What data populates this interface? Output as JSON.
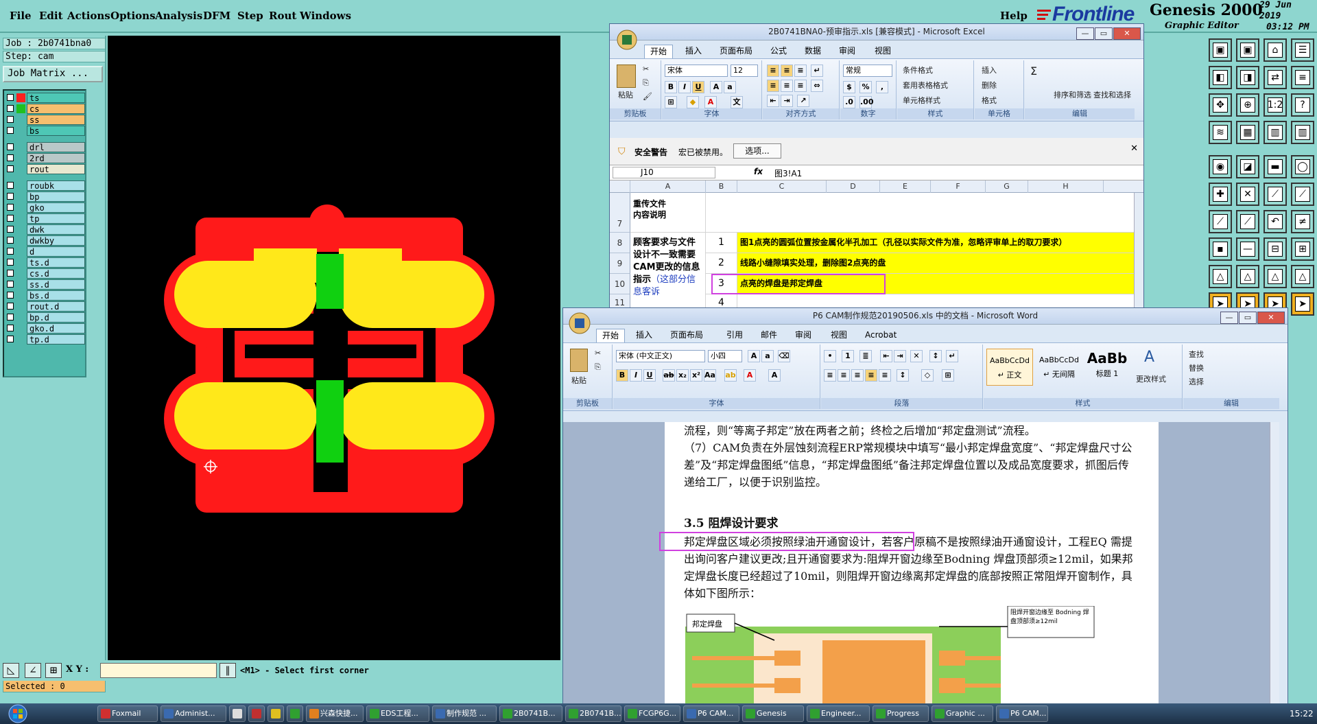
{
  "genesis": {
    "menu": [
      "File",
      "Edit",
      "Actions",
      "Options",
      "Analysis",
      "DFM",
      "Step",
      "Rout",
      "Windows"
    ],
    "help": "Help",
    "brand": "Frontline",
    "product": "Genesis 2000",
    "product_sub": "Graphic Editor",
    "date_line1": "29 Jun 2019",
    "date_line2": "03:12 PM",
    "job_label": "Job : 2b0741bna0",
    "step_label": "Step: cam",
    "job_matrix_btn": "Job Matrix ...",
    "layers": [
      {
        "name": "ts",
        "swatch": "#ff2020",
        "bg": "#4ec7b5"
      },
      {
        "name": "cs",
        "swatch": "#20c020",
        "bg": "#f6bf6f",
        "extra": "="
      },
      {
        "name": "ss",
        "swatch": "",
        "bg": "#f6bf6f"
      },
      {
        "name": "bs",
        "swatch": "",
        "bg": "#4ec7b5"
      },
      {
        "name": "drl",
        "swatch": "",
        "bg": "#b9c8c8"
      },
      {
        "name": "2rd",
        "swatch": "",
        "bg": "#b9c8c8"
      },
      {
        "name": "rout",
        "swatch": "",
        "bg": "#e8e8d0"
      },
      {
        "name": "roubk",
        "swatch": "",
        "bg": "#a8e0e8"
      },
      {
        "name": "bp",
        "swatch": "",
        "bg": "#a8e0e8"
      },
      {
        "name": "gko",
        "swatch": "",
        "bg": "#a8e0e8"
      },
      {
        "name": "tp",
        "swatch": "",
        "bg": "#a8e0e8"
      },
      {
        "name": "dwk",
        "swatch": "",
        "bg": "#a8e0e8"
      },
      {
        "name": "dwkby",
        "swatch": "",
        "bg": "#a8e0e8"
      },
      {
        "name": "d",
        "swatch": "",
        "bg": "#a8e0e8"
      },
      {
        "name": "ts.d",
        "swatch": "",
        "bg": "#a8e0e8"
      },
      {
        "name": "cs.d",
        "swatch": "",
        "bg": "#a8e0e8"
      },
      {
        "name": "ss.d",
        "swatch": "",
        "bg": "#a8e0e8"
      },
      {
        "name": "bs.d",
        "swatch": "",
        "bg": "#a8e0e8"
      },
      {
        "name": "rout.d",
        "swatch": "",
        "bg": "#a8e0e8"
      },
      {
        "name": "bp.d",
        "swatch": "",
        "bg": "#a8e0e8"
      },
      {
        "name": "gko.d",
        "swatch": "",
        "bg": "#a8e0e8"
      },
      {
        "name": "tp.d",
        "swatch": "",
        "bg": "#a8e0e8"
      }
    ],
    "selected": "Selected : 0",
    "xy_label": "X Y :",
    "prompt": "<M1> - Select first corner",
    "colors": {
      "bg": "#8ed6cf",
      "pad_red": "#ff1a1a",
      "pad_yellow": "#ffe81a",
      "trace_green": "#10d010"
    }
  },
  "excel": {
    "title": "2B0741BNA0-预审指示.xls [兼容模式] - Microsoft Excel",
    "tabs": [
      "开始",
      "插入",
      "页面布局",
      "公式",
      "数据",
      "审阅",
      "视图"
    ],
    "font_name": "宋体",
    "font_size": "12",
    "number_format": "常规",
    "groups": [
      "剪贴板",
      "字体",
      "对齐方式",
      "数字",
      "样式",
      "单元格",
      "编辑"
    ],
    "paste": "粘贴",
    "style_items": [
      "条件格式",
      "套用表格格式",
      "单元格样式"
    ],
    "cell_items": [
      "插入",
      "删除",
      "格式"
    ],
    "edit_items": [
      "排序和筛选",
      "查找和选择"
    ],
    "security_title": "安全警告",
    "security_msg": "宏已被禁用。",
    "security_btn": "选项...",
    "namebox": "J10",
    "formula": "图3!A1",
    "columns": [
      "A",
      "B",
      "C",
      "D",
      "E",
      "F",
      "G",
      "H"
    ],
    "rows": [
      {
        "num": "7",
        "a": "重传文件\n内容说明"
      },
      {
        "num": "8",
        "b": "1",
        "c": "图1点亮的圆弧位置按金属化半孔加工（孔径以实际文件为准，忽略评审单上的取刀要求）"
      },
      {
        "num": "9",
        "b": "2",
        "c": "线路小缝隙填实处理，删除图2点亮的盘"
      },
      {
        "num": "10",
        "b": "3",
        "c": "点亮的焊盘是邦定焊盘"
      },
      {
        "num": "11",
        "b": "4",
        "c": ""
      }
    ],
    "merged_a": "顾客要求与文件设计不一致需要CAM更改的信息指示",
    "merged_a_link": "（这部分信息客诉"
  },
  "word": {
    "title": "P6 CAM制作规范20190506.xls 中的文档 - Microsoft Word",
    "tabs": [
      "开始",
      "插入",
      "页面布局",
      "引用",
      "邮件",
      "审阅",
      "视图",
      "Acrobat"
    ],
    "font_name": "宋体 (中文正文)",
    "font_size": "小四",
    "groups": [
      "剪贴板",
      "字体",
      "段落",
      "样式",
      "编辑"
    ],
    "paste": "粘贴",
    "styles": [
      {
        "sample": "AaBbCcDd",
        "name": "↵ 正文"
      },
      {
        "sample": "AaBbCcDd",
        "name": "↵ 无间隔"
      },
      {
        "sample": "AaBb",
        "name": "标题 1"
      }
    ],
    "change_styles": "更改样式",
    "edit_items": [
      "查找",
      "替换",
      "选择"
    ],
    "paragraphs": [
      "流程，则“等离子邦定”放在两者之前；终检之后增加“邦定盘测试”流程。",
      "（7）CAM负责在外层蚀刻流程ERP常规模块中填写“最小邦定焊盘宽度”、“邦定焊盘尺寸公差”及“邦定焊盘图纸”信息，“邦定焊盘图纸”备注邦定焊盘位置以及成品宽度要求，抓图后传递给工厂，以便于识别监控。",
      "3.5  阻焊设计要求",
      "邦定焊盘区域必须按照绿油开通窗设计，若客户原稿不是按照绿油开通窗设计，工程EQ 需提出询问客户建议更改;且开通窗要求为:阻焊开窗边缘至Bodning 焊盘顶部须≥12mil，如果邦定焊盘长度已经超过了10mil，则阻焊开窗边缘离邦定焊盘的底部按照正常阻焊开窗制作，具体如下图所示："
    ],
    "fig_label_left": "邦定焊盘",
    "fig_label_right": "阻焊开窗边缘至 Bodning 焊盘顶部须≥12mil"
  },
  "taskbar": {
    "tasks": [
      {
        "label": "Foxmail",
        "color": "#d03030"
      },
      {
        "label": "Administ...",
        "color": "#3a6ab0"
      },
      {
        "label": "",
        "color": "#dddddd"
      },
      {
        "label": "",
        "color": "#c03030"
      },
      {
        "label": "",
        "color": "#e0c020"
      },
      {
        "label": "",
        "color": "#30a030"
      },
      {
        "label": "兴森快捷...",
        "color": "#e08020"
      },
      {
        "label": "EDS工程...",
        "color": "#30a030"
      },
      {
        "label": "制作规范 ...",
        "color": "#3a6ab0"
      },
      {
        "label": "2B0741B...",
        "color": "#30a030"
      },
      {
        "label": "2B0741B...",
        "color": "#30a030"
      },
      {
        "label": "FCGP6G...",
        "color": "#30a030"
      },
      {
        "label": "P6 CAM...",
        "color": "#3a6ab0"
      },
      {
        "label": "Genesis",
        "color": "#30a030"
      },
      {
        "label": "Engineer...",
        "color": "#30a030"
      },
      {
        "label": "Progress",
        "color": "#30a030"
      },
      {
        "label": "Graphic ...",
        "color": "#30a030"
      },
      {
        "label": "P6 CAM...",
        "color": "#3a6ab0"
      }
    ],
    "clock": "15:22"
  }
}
